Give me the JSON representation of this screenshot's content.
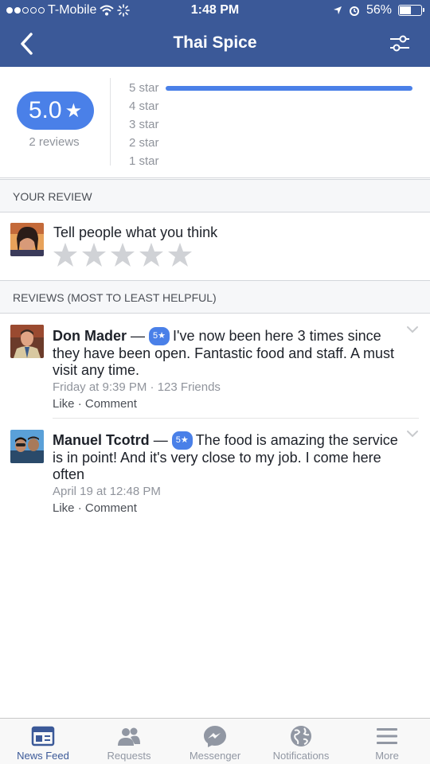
{
  "status_bar": {
    "carrier": "T-Mobile",
    "time": "1:48 PM",
    "battery": "56%",
    "battery_level": 0.56
  },
  "nav": {
    "title": "Thai Spice",
    "back_icon": "chevron-left-icon",
    "filter_icon": "sliders-icon"
  },
  "summary": {
    "score": "5.0",
    "score_star": "★",
    "reviews_count": "2 reviews",
    "rows": [
      {
        "label": "5 star",
        "fraction": 1.0
      },
      {
        "label": "4 star",
        "fraction": 0
      },
      {
        "label": "3 star",
        "fraction": 0
      },
      {
        "label": "2 star",
        "fraction": 0
      },
      {
        "label": "1 star",
        "fraction": 0
      }
    ]
  },
  "your_review": {
    "header": "YOUR REVIEW",
    "prompt": "Tell people what you think"
  },
  "reviews": {
    "header": "REVIEWS (MOST TO LEAST HELPFUL)",
    "items": [
      {
        "author": "Don Mader",
        "dash": "—",
        "badge": "5★",
        "text": "I've now been here 3 times since they have been open. Fantastic food and staff. A must visit any time.",
        "meta": "Friday at 9:39 PM · 123 Friends",
        "like": "Like",
        "sep": "·",
        "comment": "Comment"
      },
      {
        "author": "Manuel Tcotrd",
        "dash": "—",
        "badge": "5★",
        "text": "The food is amazing the service is in point!  And it's very close to my job. I come here often",
        "meta": "April 19 at 12:48 PM",
        "like": "Like",
        "sep": "·",
        "comment": "Comment"
      }
    ]
  },
  "tabbar": {
    "tabs": [
      {
        "label": "News Feed",
        "icon": "news-feed-icon",
        "active": true
      },
      {
        "label": "Requests",
        "icon": "friends-icon"
      },
      {
        "label": "Messenger",
        "icon": "messenger-icon"
      },
      {
        "label": "Notifications",
        "icon": "globe-icon"
      },
      {
        "label": "More",
        "icon": "menu-icon"
      }
    ]
  },
  "colors": {
    "brand": "#3b5998",
    "accent": "#4a80e8"
  }
}
